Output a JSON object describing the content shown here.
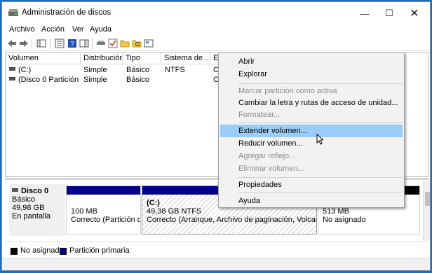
{
  "window": {
    "title": "Administración de discos",
    "minimize_glyph": "—",
    "maximize_glyph": "☐",
    "close_glyph": "✕"
  },
  "menubar": [
    "Archivo",
    "Acción",
    "Ver",
    "Ayuda"
  ],
  "toolbar_icons": [
    "back-icon",
    "forward-icon",
    "console-tree-icon",
    "properties-icon",
    "help-icon",
    "action-pane-icon",
    "connect-icon",
    "check-icon",
    "folder-icon",
    "search-icon",
    "view-icon"
  ],
  "volume_list": {
    "columns": [
      "Volumen",
      "Distribución",
      "Tipo",
      "Sistema de ...",
      "Es"
    ],
    "rows": [
      {
        "volumen": "(C:)",
        "distribucion": "Simple",
        "tipo": "Básico",
        "sistema": "NTFS",
        "estado": "Co"
      },
      {
        "volumen": "(Disco 0 Partición 1)",
        "distribucion": "Simple",
        "tipo": "Básico",
        "sistema": "",
        "estado": "Co"
      }
    ]
  },
  "disk": {
    "name": "Disco 0",
    "type": "Básico",
    "size": "49,98 GB",
    "status": "En pantalla",
    "partitions": [
      {
        "line1": "100 MB",
        "line2": "Correcto (Partición de",
        "stripe_color": "#00008b"
      },
      {
        "line0": "(C:)",
        "line1": "49,38 GB NTFS",
        "line2": "Correcto (Arranque, Archivo de paginación, Volcado, Pa",
        "stripe_color": "#00008b"
      },
      {
        "line1": "513 MB",
        "line2": "No asignado",
        "stripe_color": "#000000"
      }
    ]
  },
  "legend": [
    {
      "label": "No asignado",
      "color": "#000000"
    },
    {
      "label": "Partición primaria",
      "color": "#00008b"
    }
  ],
  "context_menu": {
    "items": [
      {
        "label": "Abrir",
        "enabled": true
      },
      {
        "label": "Explorar",
        "enabled": true
      },
      {
        "label": "Marcar partición como activa",
        "enabled": false
      },
      {
        "label": "Cambiar la letra y rutas de acceso de unidad...",
        "enabled": true
      },
      {
        "label": "Formatear...",
        "enabled": false
      },
      {
        "label": "Extender volumen...",
        "enabled": true,
        "highlighted": true
      },
      {
        "label": "Reducir volumen...",
        "enabled": true
      },
      {
        "label": "Agregar reflejo...",
        "enabled": false
      },
      {
        "label": "Eliminar volumen...",
        "enabled": false
      },
      {
        "label": "Propiedades",
        "enabled": true
      },
      {
        "label": "Ayuda",
        "enabled": true
      }
    ]
  },
  "colors": {
    "highlight": "#99ccf7",
    "primary_partition": "#00008b",
    "unallocated": "#000000"
  }
}
